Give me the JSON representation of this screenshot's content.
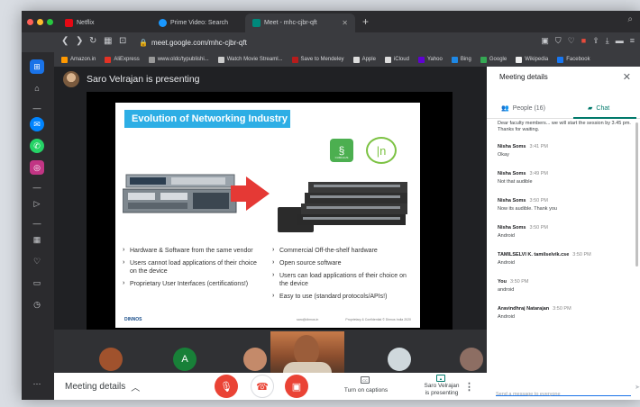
{
  "browser": {
    "tabs": [
      {
        "label": "Netflix",
        "color": "#e50914"
      },
      {
        "label": "Prime Video: Search",
        "color": "#1a98ff"
      },
      {
        "label": "Meet - mhc-cjbr-qft",
        "color": "#00897b"
      }
    ],
    "new_tab": "+",
    "url": "meet.google.com/mhc-cjbr-qft",
    "bookmarks": [
      {
        "label": "Amazon.in",
        "color": "#ff9900"
      },
      {
        "label": "AliExpress",
        "color": "#e43225"
      },
      {
        "label": "www.oldc/typublishi...",
        "color": "#999999"
      },
      {
        "label": "Watch Movie Streaml...",
        "color": "#cccccc"
      },
      {
        "label": "Save to Mendeley",
        "color": "#b71c1c"
      },
      {
        "label": "Apple",
        "color": "#dddddd"
      },
      {
        "label": "iCloud",
        "color": "#dddddd"
      },
      {
        "label": "Yahoo",
        "color": "#6001d2"
      },
      {
        "label": "Bing",
        "color": "#1e88e5"
      },
      {
        "label": "Google",
        "color": "#34a853"
      },
      {
        "label": "Wikipedia",
        "color": "#eeeeee"
      },
      {
        "label": "Facebook",
        "color": "#1877f2"
      }
    ]
  },
  "meet": {
    "presenting_text": "Saro Velrajan is presenting",
    "slide": {
      "title": "Evolution of Networking Industry",
      "logo_cumulus": "CUMULUS",
      "left_bullets": [
        "Hardware & Software from the same vendor",
        "Users cannot load applications of their choice on the device",
        "Proprietary User Interfaces (certifications!)"
      ],
      "right_bullets": [
        "Commercial Off-the-shelf hardware",
        "Open source software",
        "Users can load applications of their choice on the device",
        "Easy to use (standard protocols/APIs!)"
      ],
      "footer_brand": "DINNOS",
      "footer_email": "saro@dinnos.in",
      "footer_legal": "Proprietary & Confidential © Dinnos India 2020"
    },
    "participants": [
      {
        "letter": "",
        "color": "#a0522d"
      },
      {
        "letter": "A",
        "color": "#188038"
      },
      {
        "letter": "",
        "color": "#c48a6a"
      },
      {
        "letter": "",
        "color": "#cfd8dc"
      },
      {
        "letter": "",
        "color": "#8d6e63"
      }
    ],
    "bottom": {
      "meeting_details": "Meeting details",
      "captions": "Turn on captions",
      "presenting": "Saro Velrajan\nis presenting"
    }
  },
  "panel": {
    "title": "Meeting details",
    "tab_people": "People (16)",
    "tab_chat": "Chat",
    "first_msg": "Dear faculty members... we will start the session by 3.45 pm. Thanks for waiting.",
    "messages": [
      {
        "sender": "Nisha Soms",
        "time": "3:41 PM",
        "text": "Okay"
      },
      {
        "sender": "Nisha Soms",
        "time": "3:49 PM",
        "text": "Not that audible"
      },
      {
        "sender": "Nisha Soms",
        "time": "3:50 PM",
        "text": "Now its audible. Thank you"
      },
      {
        "sender": "Nisha Soms",
        "time": "3:50 PM",
        "text": "Android"
      },
      {
        "sender": "TAMILSELVI K. tamilselvik.cse",
        "time": "3:50 PM",
        "text": "Android"
      },
      {
        "sender": "You",
        "time": "3:50 PM",
        "text": "android"
      },
      {
        "sender": "Aravindhraj Natarajan",
        "time": "3:50 PM",
        "text": "Android"
      }
    ],
    "send_placeholder": "Send a message to everyone"
  },
  "colors": {
    "mic_off": "#ea4335",
    "meet_accent": "#00796b"
  }
}
